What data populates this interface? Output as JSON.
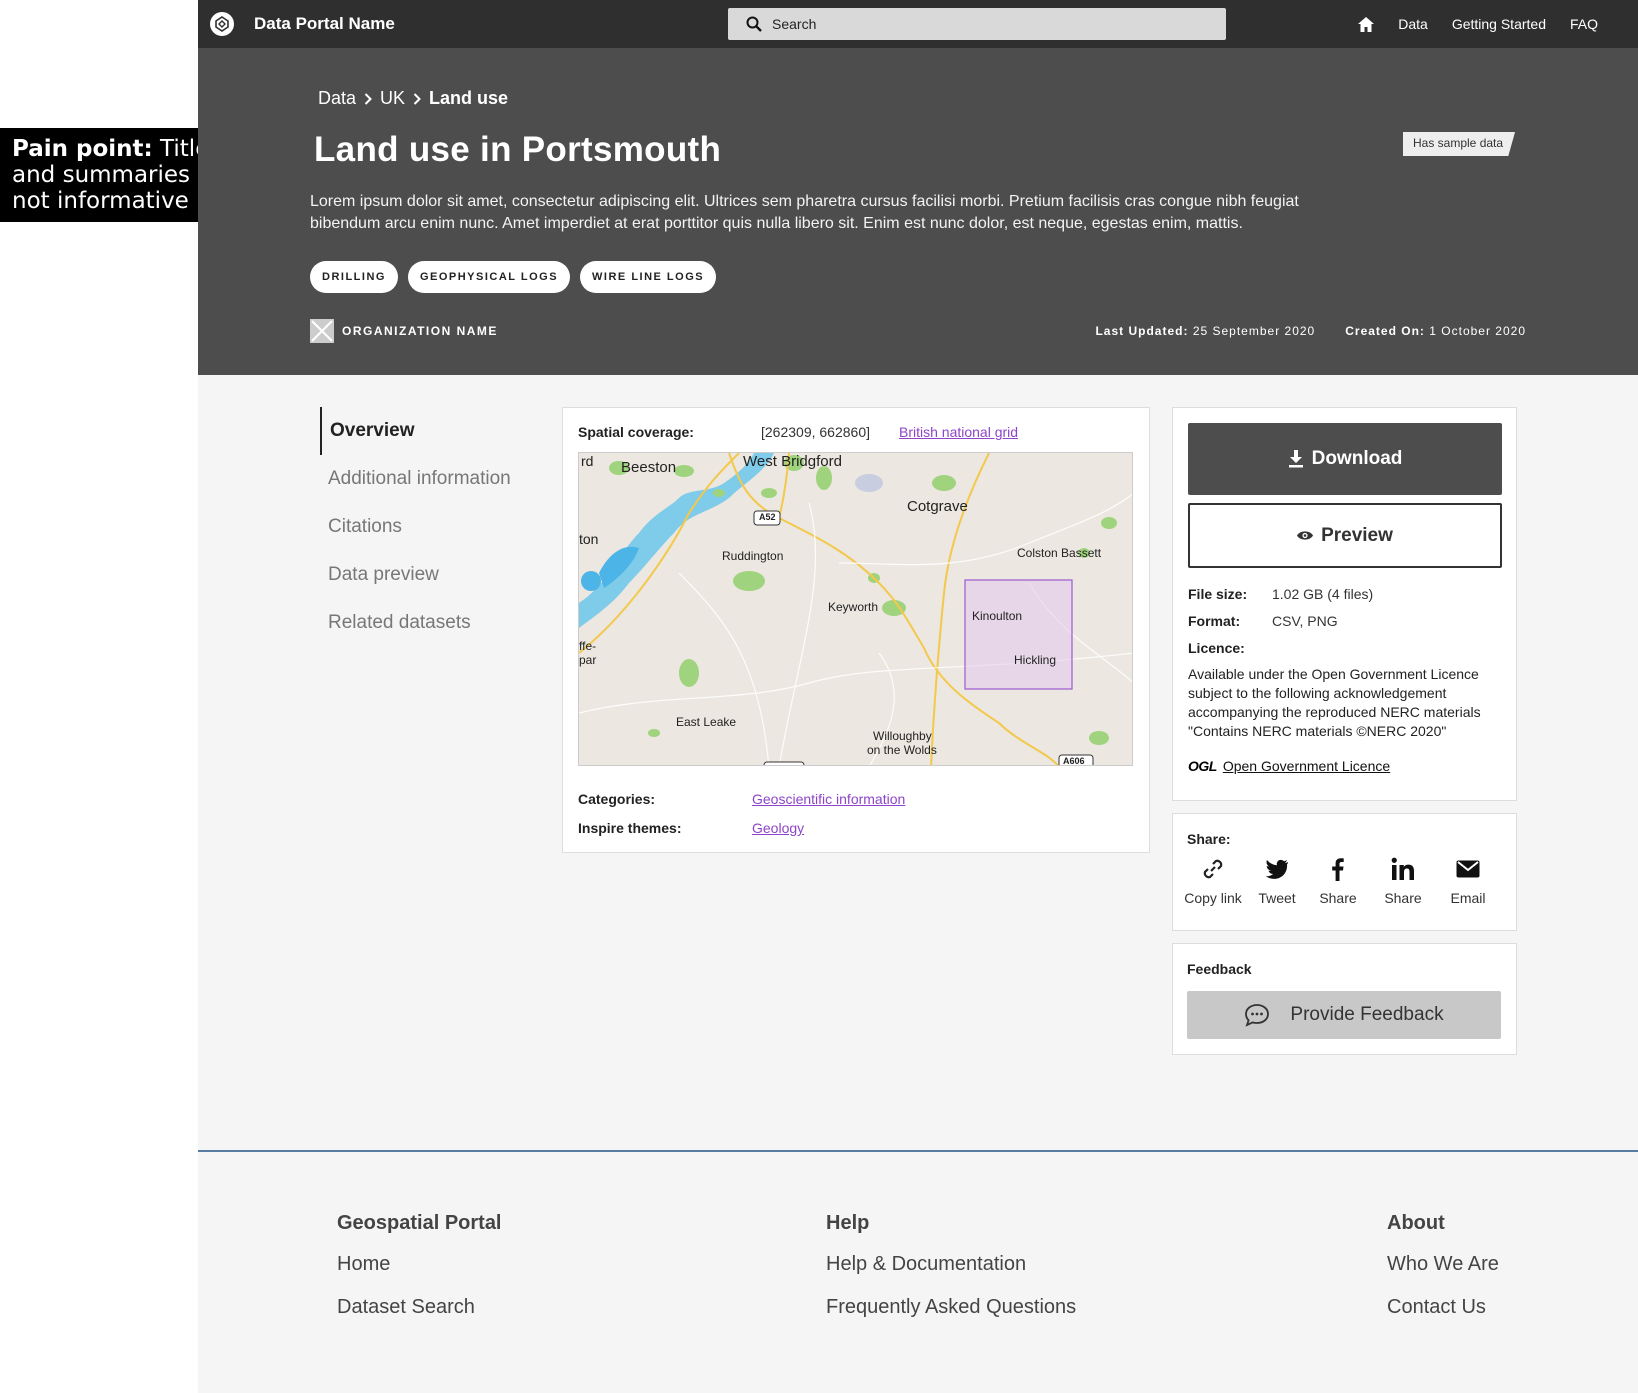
{
  "annotation": {
    "bold": "Pain point:",
    "text": " Titles and summaries are not informative"
  },
  "topbar": {
    "portal_name": "Data Portal Name",
    "search_placeholder": "Search",
    "nav": [
      "Data",
      "Getting Started",
      "FAQ"
    ]
  },
  "hero": {
    "breadcrumbs": [
      "Data",
      "UK",
      "Land use"
    ],
    "title": "Land use in Portsmouth",
    "badge": "Has sample data",
    "description": "Lorem ipsum dolor sit amet, consectetur adipiscing elit. Ultrices sem pharetra cursus facilisi morbi. Pretium facilisis cras congue nibh feugiat bibendum arcu enim nunc. Amet imperdiet at erat porttitor quis nulla libero sit. Enim est nunc dolor, est neque, egestas enim, mattis.",
    "tags": [
      "DRILLING",
      "GEOPHYSICAL LOGS",
      "WIRE LINE LOGS"
    ],
    "organization": "ORGANIZATION NAME",
    "last_updated_label": "Last Updated:",
    "last_updated": "25 September 2020",
    "created_label": "Created On:",
    "created": "1 October 2020"
  },
  "sidenav": [
    "Overview",
    "Additional information",
    "Citations",
    "Data preview",
    "Related datasets"
  ],
  "overview": {
    "spatial_label": "Spatial coverage:",
    "spatial_value": "[262309, 662860]",
    "spatial_link": "British national grid",
    "map_labels": [
      "rd",
      "Beeston",
      "West Bridgford",
      "Cotgrave",
      "ton",
      "Ruddington",
      "Colston Bassett",
      "Keyworth",
      "Kinoulton",
      "Hickling",
      "ffe-",
      "par",
      "East Leake",
      "Willoughby",
      "on the Wolds",
      "A52",
      "A606"
    ],
    "categories_label": "Categories:",
    "categories": "Geoscientific information",
    "themes_label": "Inspire themes:",
    "themes": "Geology"
  },
  "side": {
    "download": "Download",
    "preview": "Preview",
    "filesize_label": "File size:",
    "filesize": "1.02 GB (4 files)",
    "format_label": "Format:",
    "format": "CSV, PNG",
    "licence_label": "Licence:",
    "licence_text": "Available under the Open Government Licence subject to the following acknowledgement accompanying the reproduced NERC materials \"Contains NERC materials ©NERC 2020\"",
    "ogl_badge": "OGL",
    "ogl_link": "Open Government Licence"
  },
  "share": {
    "label": "Share:",
    "items": [
      "Copy link",
      "Tweet",
      "Share",
      "Share",
      "Email"
    ]
  },
  "feedback": {
    "label": "Feedback",
    "button": "Provide Feedback"
  },
  "footer": {
    "col1": {
      "heading": "Geospatial Portal",
      "links": [
        "Home",
        "Dataset Search"
      ]
    },
    "col2": {
      "heading": "Help",
      "links": [
        "Help & Documentation",
        "Frequently Asked Questions"
      ]
    },
    "col3": {
      "heading": "About",
      "links": [
        "Who We Are",
        "Contact Us"
      ]
    }
  }
}
